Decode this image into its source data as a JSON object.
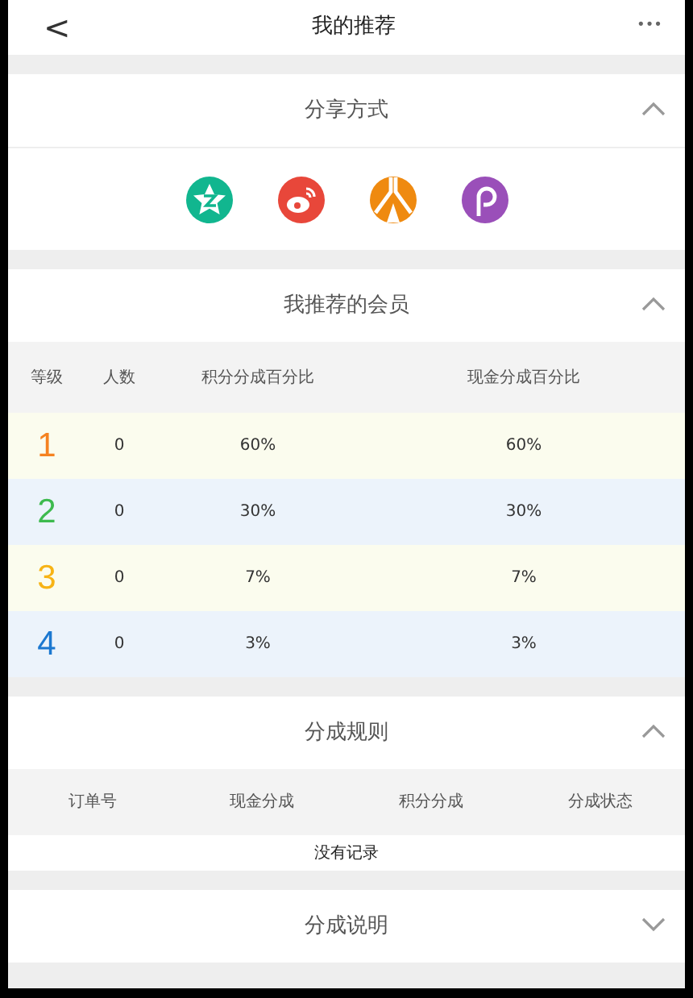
{
  "header": {
    "back": "<",
    "title": "我的推荐",
    "more": "•••"
  },
  "sections": [
    {
      "kind": "share",
      "title": "分享方式",
      "expanded": true,
      "items": [
        {
          "kind": "qzone"
        },
        {
          "kind": "weibo"
        },
        {
          "kind": "renren"
        },
        {
          "kind": "pengyou"
        }
      ]
    },
    {
      "kind": "members",
      "title": "我推荐的会员",
      "expanded": true,
      "columns": [
        "等级",
        "人数",
        "积分分成百分比",
        "现金分成百分比"
      ],
      "rows": [
        {
          "level": "1",
          "color": "#f58220",
          "count": "0",
          "points": "60%",
          "cash": "60%"
        },
        {
          "level": "2",
          "color": "#3dba4e",
          "count": "0",
          "points": "30%",
          "cash": "30%"
        },
        {
          "level": "3",
          "color": "#f7b315",
          "count": "0",
          "points": "7%",
          "cash": "7%"
        },
        {
          "level": "4",
          "color": "#1c78d0",
          "count": "0",
          "points": "3%",
          "cash": "3%"
        }
      ]
    },
    {
      "kind": "rules",
      "title": "分成规则",
      "expanded": true,
      "columns": [
        "订单号",
        "现金分成",
        "积分分成",
        "分成状态"
      ],
      "empty": "没有记录"
    },
    {
      "kind": "info",
      "title": "分成说明",
      "expanded": false
    }
  ]
}
